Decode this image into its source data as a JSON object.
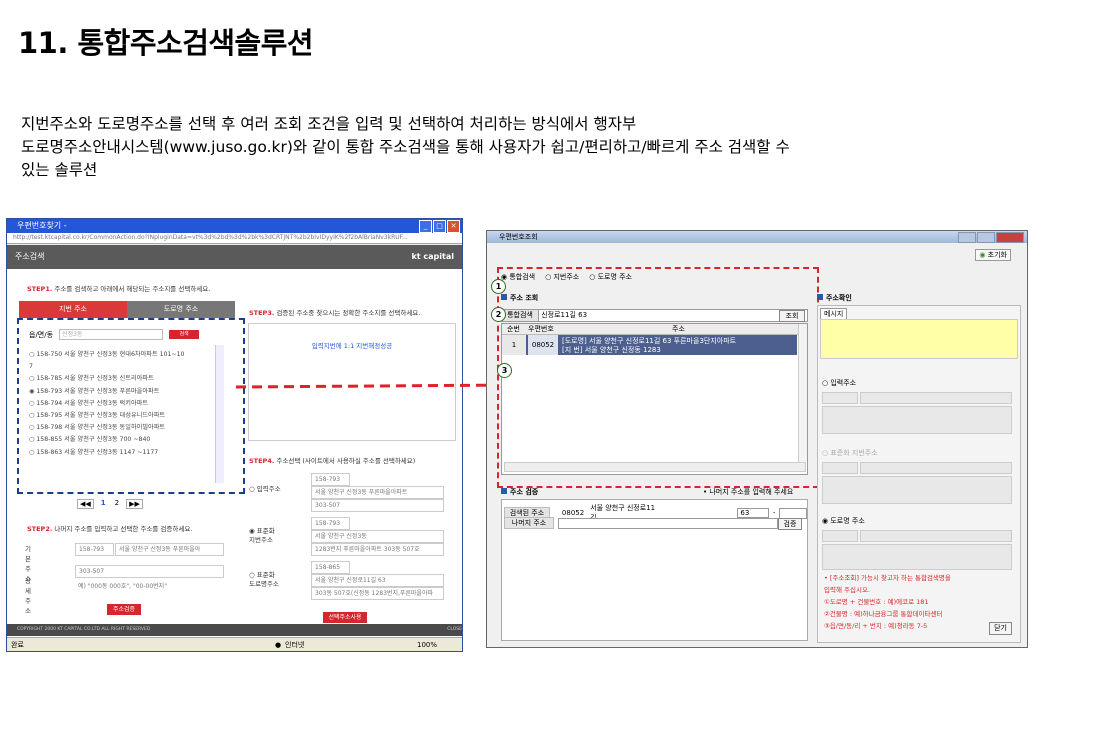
{
  "heading": "11. 통합주소검색솔루션",
  "description": [
    "지번주소와 도로명주소를 선택 후 여러 조회 조건을 입력 및 선택하여 처리하는 방식에서 행자부",
    "도로명주소안내시스템(www.juso.go.kr)와 같이 통합 주소검색을 통해 사용자가 쉽고/편리하고/빠르게 주소 검색할 수",
    "있는 솔루션"
  ],
  "left_window": {
    "title": "우편번호찾기 -",
    "address": "http://test.ktcapital.co.kr/CommonAction.do?INpluginData=vt%3d%2bd%3d%2bk%3dCRTJNT%2b2bIvIDyyIK%2f2bAlBriaNv3kRUF...",
    "header": "주소검색",
    "brand": "kt capital",
    "step1_label": "STEP1.",
    "step1_text": "주소를 검색하고 아래에서 해당되는 주소지를 선택하세요.",
    "tab_jibun": "지번 주소",
    "tab_road": "도로명 주소",
    "search_label": "읍/면/동",
    "search_placeholder": "신정3동",
    "search_button": "검색",
    "list": [
      "○ 158-750  서울 양천구  신정3동 현대6차아파트  101~10",
      "  7",
      "○ 158-785  서울 양천구  신정3동 신트리아파트",
      "◉ 158-793  서울 양천구  신정3동 푸른마을아파트",
      "○ 158-794  서울 양천구  신정3동 럭키아파트",
      "○ 158-795  서울 양천구  신정3동 대성유니드아파트",
      "○ 158-798  서울 양천구  신정3동 동일하이빌아파트",
      "○ 158-855  서울 양천구  신정3동  700 ~840",
      "○ 158-863  서울 양천구  신정3동  1147 ~1177"
    ],
    "pager": [
      "◀◀",
      "1",
      "2",
      "▶▶"
    ],
    "step2_label": "STEP2.",
    "step2_text": "나머지 주소를 입력하고 선택한 주소를 검증하세요.",
    "basic_addr_label": "기본주소",
    "basic_zip": "158-793",
    "basic_addr": "서울 양천구 신정3동  푸른마을아",
    "detail_label": "상세주소",
    "detail_value": "303-507",
    "detail_hint": "예) \"000동 000호\",  \"00-00번지\"",
    "verify_button": "주소검증",
    "step3_label": "STEP3.",
    "step3_text": "검증된 주소중 찾으시는 정확한 주소지를 선택하세요.",
    "step3_result": "입력지번에 1:1 지번해정성공",
    "step4_label": "STEP4.",
    "step4_text": "주소선택 (사이트에서 사용하실 주소를 선택하세요)",
    "opt_input": "입력주소",
    "opt_input_zip": "158-793",
    "opt_input_addr": "서울 양천구 신정3동   푸른마을아파트",
    "opt_input_detail": "303-507",
    "opt_std_jibun": "표준화\n지번주소",
    "std_jibun_zip": "158-793",
    "std_jibun_addr": "서울 양천구 신정3동",
    "std_jibun_detail": "1283번지 푸른마을아파트 303동 507호",
    "opt_std_road": "표준화\n도로명주소",
    "std_road_zip": "158-865",
    "std_road_addr": "서울 양천구 신정로11길  63",
    "std_road_detail": "303동 507호(신정동 1283번지,푸른마을아파",
    "use_button": "선택주소사용",
    "footer": "COPYRIGHT 2000 KT CAPITAL CO.LTD ALL RIGHT RESERVED",
    "footer_close": "CLOSE",
    "status_done": "완료",
    "status_zone": "인터넷",
    "status_zoom": "100%"
  },
  "right_window": {
    "title": "우편번호조회",
    "reset_button": "초기화",
    "radio_integrated": "통합검색",
    "radio_jibun": "지번주소",
    "radio_road": "도로명 주소",
    "section_search": "주소 조회",
    "search_label": "통합검색",
    "search_value": "신정로11길 63",
    "search_button": "조회",
    "col_no": "순번",
    "col_zip": "우편번호",
    "col_addr": "주소",
    "row_no": "1",
    "row_zip": "08052",
    "row_addr1": "[도로명] 서울 양천구 신정로11길 63 푸른마을3단지아파트",
    "row_addr2": "[지   번] 서울 양천구 신정동  1283",
    "section_verify": "주소 검증",
    "verify_hint": "• 나머지 주소를 입력해 주세요",
    "verify_label": "검색된 주소",
    "verify_zip": "08052",
    "verify_addr": "서울 양천구 신정로11길",
    "verify_num": "63",
    "verify_dash": "-",
    "rest_label": "나머지 주소",
    "verify_button": "검증",
    "section_confirm": "주소확인",
    "msg_tab": "메시지",
    "opt_input": "입력주소",
    "opt_std_jibun": "표준화 지번주소",
    "opt_road": "도로명 주소",
    "notes": [
      "• [주소조회] 가능시 찾고자 하는 통합검색명을",
      "   입력해 주십시오.",
      "①도로명 + 건물번호 : 예)에코로 181",
      "②건물명 : 예)하나금융그룹 통합데이타센터",
      "③읍/면/동/리 + 번지 : 예)청라동 7-5"
    ],
    "close_button": "닫기",
    "markers": [
      "1",
      "2",
      "3"
    ]
  }
}
